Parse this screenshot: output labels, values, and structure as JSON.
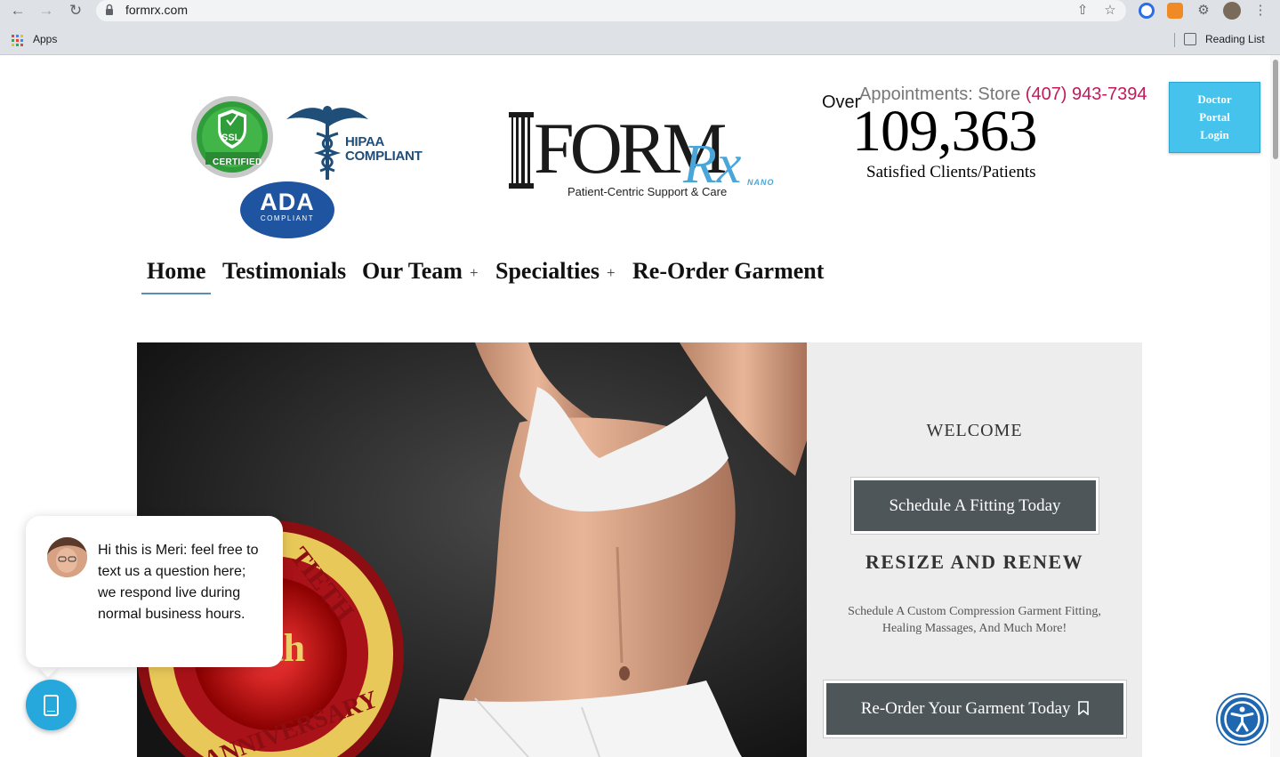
{
  "browser": {
    "url": "formrx.com",
    "apps_label": "Apps",
    "reading_list_label": "Reading List"
  },
  "badges": {
    "ssl_top": "SSL",
    "ssl_ribbon": "CERTIFIED",
    "hipaa_line1": "HIPAA",
    "hipaa_line2": "COMPLIANT",
    "ada_big": "ADA",
    "ada_small": "COMPLIANT"
  },
  "logo": {
    "word": "FORM",
    "rx": "Rx",
    "nano": "NANO",
    "tagline": "Patient-Centric Support & Care"
  },
  "stats": {
    "appointments_label": "Appointments: Store ",
    "phone": "(407) 943-7394",
    "over": "Over",
    "count": "109,363",
    "count_label": "Satisfied Clients/Patients"
  },
  "doctor_portal": {
    "line1": "Doctor",
    "line2": "Portal",
    "line3": "Login"
  },
  "nav": {
    "items": [
      {
        "label": "Home"
      },
      {
        "label": "Testimonials"
      },
      {
        "label": "Our Team"
      },
      {
        "label": "Specialties"
      },
      {
        "label": "Re-Order Garment"
      }
    ],
    "plus": "+"
  },
  "hero": {
    "seal_text_top": "TIETH",
    "seal_text_mid": "th",
    "seal_text_bottom": "ANNIVERSARY"
  },
  "panel": {
    "welcome": "WELCOME",
    "schedule_button": "Schedule A Fitting Today",
    "heading": "RESIZE AND RENEW",
    "subtext": "Schedule A Custom Compression Garment Fitting, Healing Massages, And Much More!",
    "reorder_button": "Re-Order Your Garment Today"
  },
  "chat": {
    "message": "Hi this is Meri: feel free to text us a question here; we respond live during normal business hours."
  },
  "colors": {
    "accent_blue": "#45c3ec",
    "phone_pink": "#c2185b",
    "button_gray": "#4f5659",
    "chat_blue": "#27a8dc",
    "a11y_blue": "#1f67b1"
  }
}
